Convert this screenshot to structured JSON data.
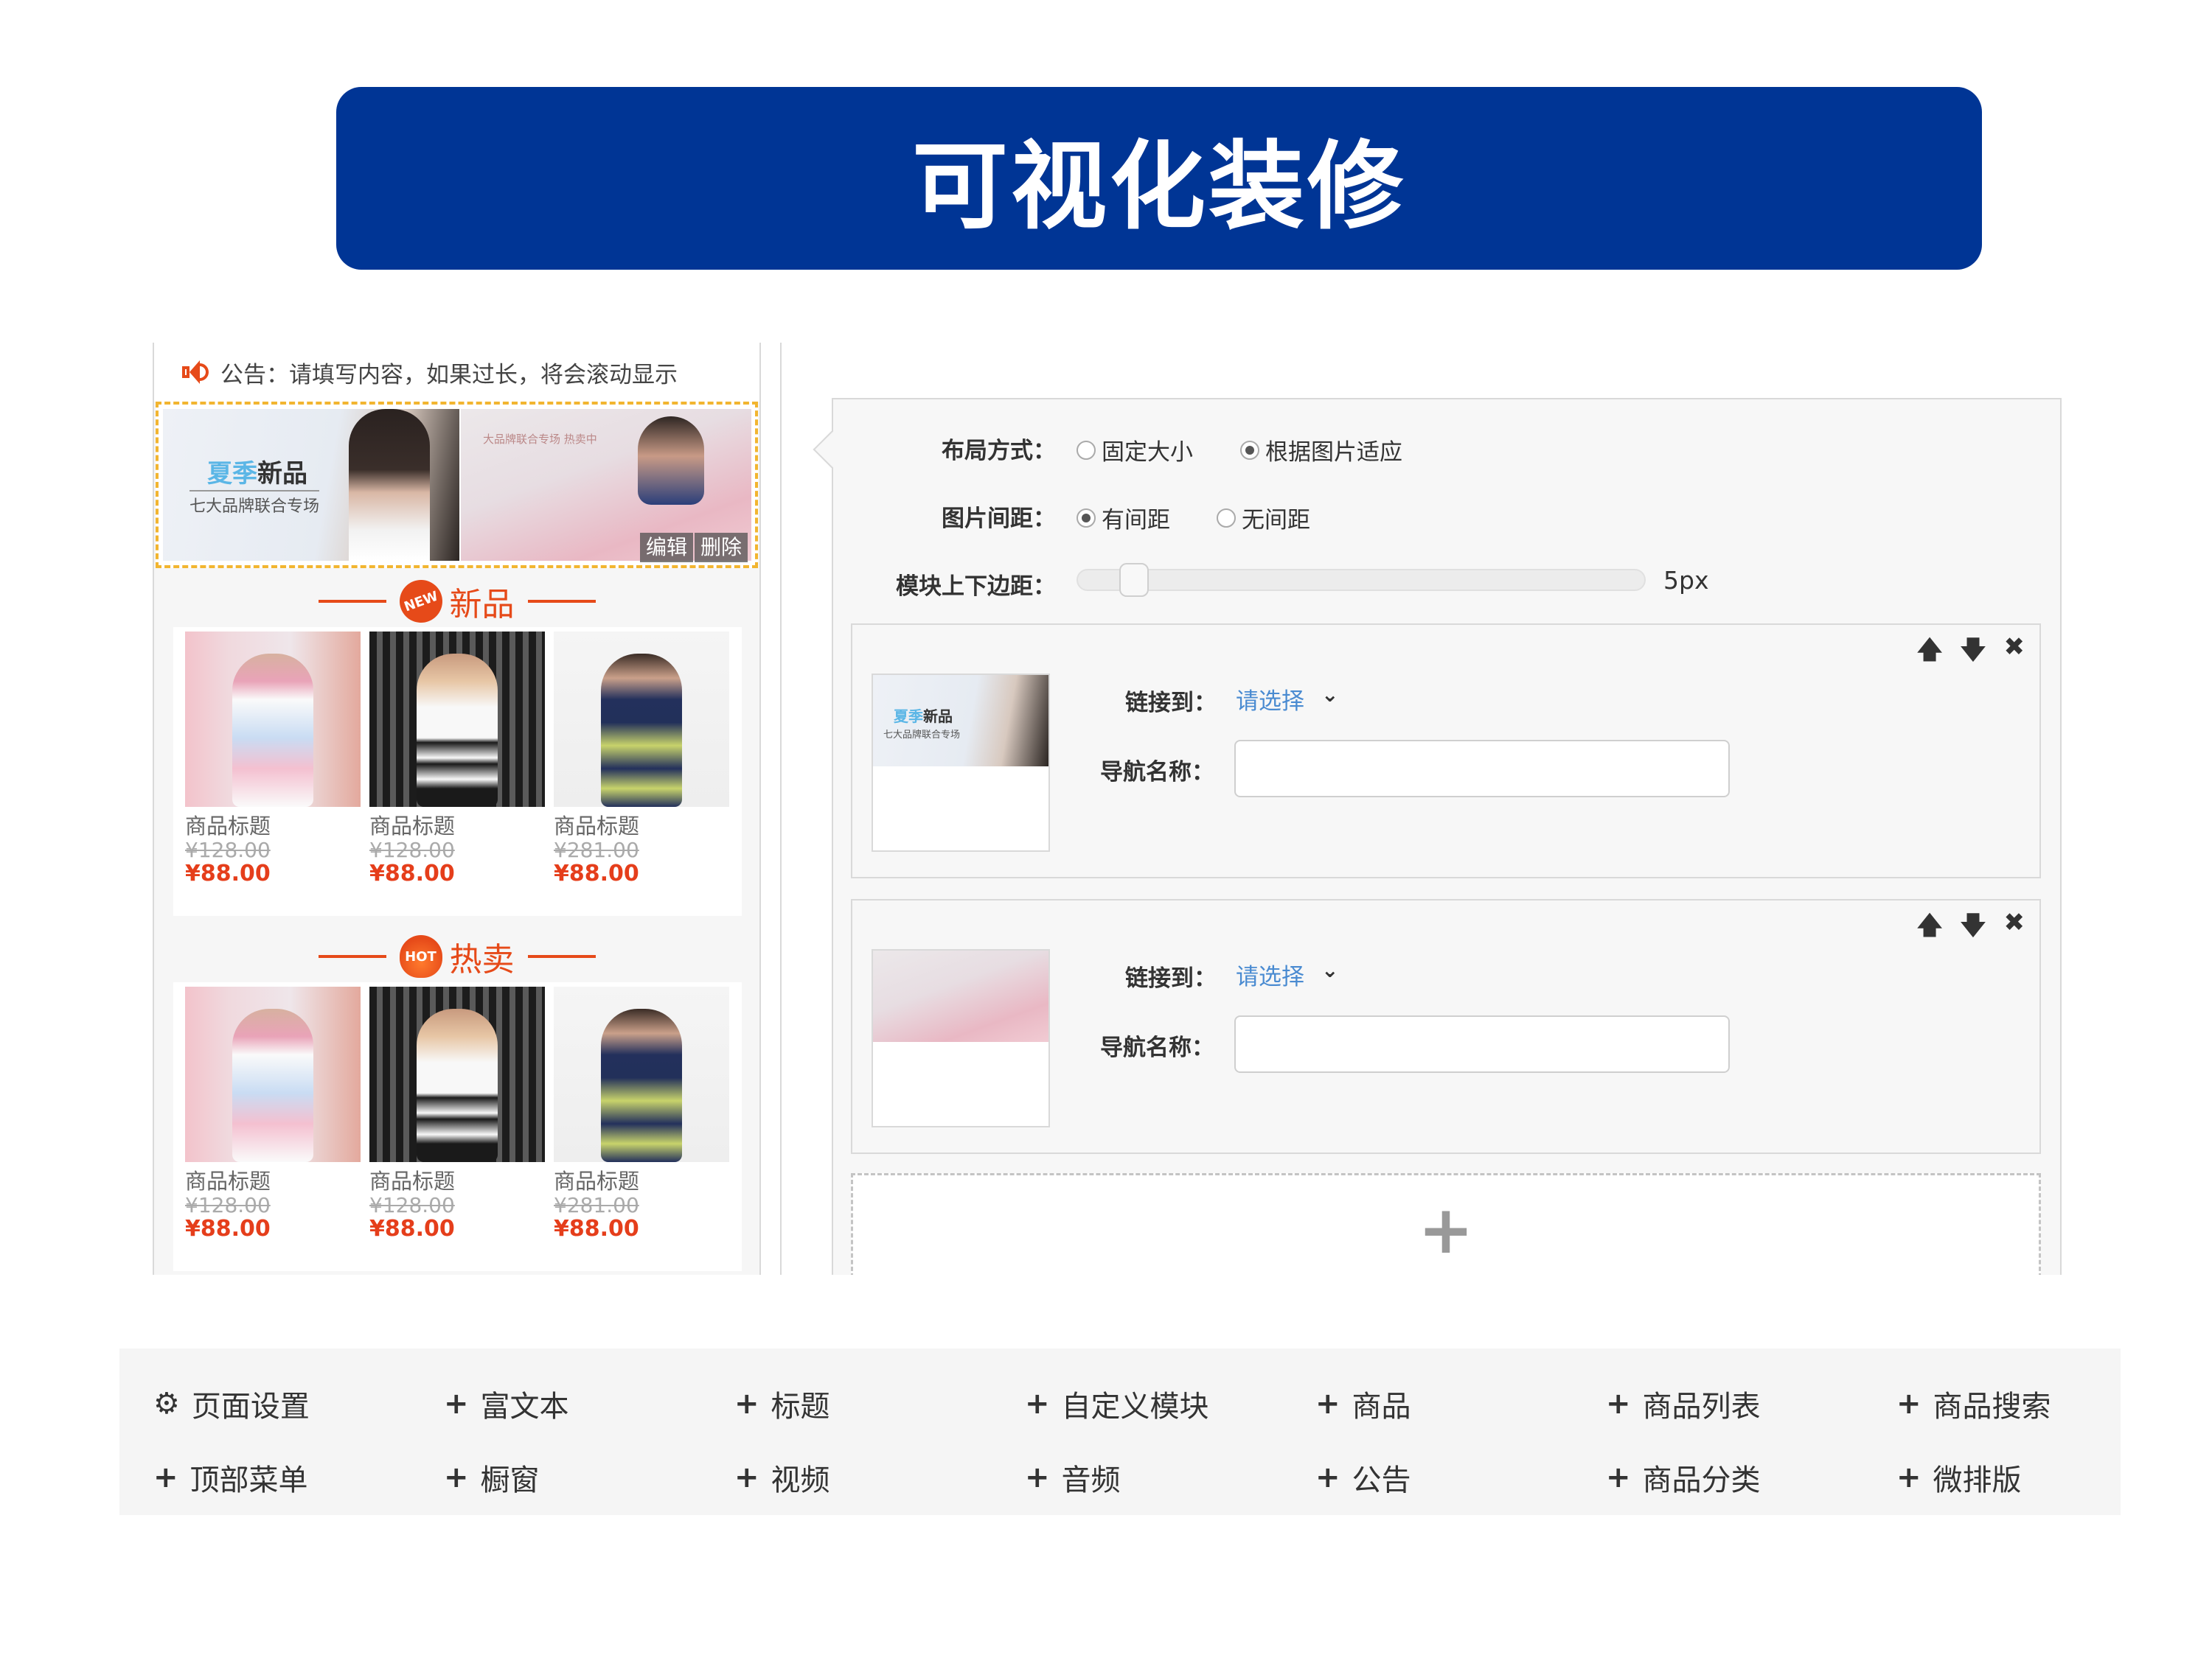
{
  "header": {
    "title": "可视化装修"
  },
  "preview": {
    "notice": "公告：请填写内容，如果过长，将会滚动显示",
    "banner_a": {
      "highlight": "夏季",
      "title": "新品",
      "subtitle": "七大品牌联合专场"
    },
    "banner_b": {
      "caption": "大品牌联合专场 热卖中"
    },
    "edit_label": "编辑",
    "delete_label": "删除",
    "sections": [
      {
        "title": "新品",
        "badge": "NEW",
        "goods": [
          {
            "name": "商品标题",
            "old_price": "¥128.00",
            "price": "¥88.00"
          },
          {
            "name": "商品标题",
            "old_price": "¥128.00",
            "price": "¥88.00"
          },
          {
            "name": "商品标题",
            "old_price": "¥281.00",
            "price": "¥88.00"
          }
        ]
      },
      {
        "title": "热卖",
        "badge": "HOT",
        "goods": [
          {
            "name": "商品标题",
            "old_price": "¥128.00",
            "price": "¥88.00"
          },
          {
            "name": "商品标题",
            "old_price": "¥128.00",
            "price": "¥88.00"
          },
          {
            "name": "商品标题",
            "old_price": "¥281.00",
            "price": "¥88.00"
          }
        ]
      }
    ]
  },
  "config": {
    "layout_label": "布局方式：",
    "layout_options": [
      "固定大小",
      "根据图片适应"
    ],
    "layout_selected": 1,
    "spacing_label": "图片间距：",
    "spacing_options": [
      "有间距",
      "无间距"
    ],
    "spacing_selected": 0,
    "margin_label": "模块上下边距：",
    "margin_value": "5px",
    "margin_fraction": 0.05,
    "items": [
      {
        "link_label": "链接到：",
        "link_value": "请选择",
        "nav_label": "导航名称：",
        "nav_value": "",
        "thumb_title": "新品",
        "thumb_highlight": "夏季",
        "thumb_sub": "七大品牌联合专场"
      },
      {
        "link_label": "链接到：",
        "link_value": "请选择",
        "nav_label": "导航名称：",
        "nav_value": ""
      }
    ],
    "tools": {
      "up": "🡅",
      "down": "🡇",
      "close": "✖"
    },
    "add_symbol": "+"
  },
  "toolbar": {
    "items": [
      {
        "icon": "gear-icon",
        "label": "页面设置"
      },
      {
        "icon": "plus-icon",
        "label": "富文本"
      },
      {
        "icon": "plus-icon",
        "label": "标题"
      },
      {
        "icon": "plus-icon",
        "label": "自定义模块"
      },
      {
        "icon": "plus-icon",
        "label": "商品"
      },
      {
        "icon": "plus-icon",
        "label": "商品列表"
      },
      {
        "icon": "plus-icon",
        "label": "商品搜索"
      },
      {
        "icon": "plus-icon",
        "label": "顶部菜单"
      },
      {
        "icon": "plus-icon",
        "label": "橱窗"
      },
      {
        "icon": "plus-icon",
        "label": "视频"
      },
      {
        "icon": "plus-icon",
        "label": "音频"
      },
      {
        "icon": "plus-icon",
        "label": "公告"
      },
      {
        "icon": "plus-icon",
        "label": "商品分类"
      },
      {
        "icon": "plus-icon",
        "label": "微排版"
      }
    ]
  }
}
